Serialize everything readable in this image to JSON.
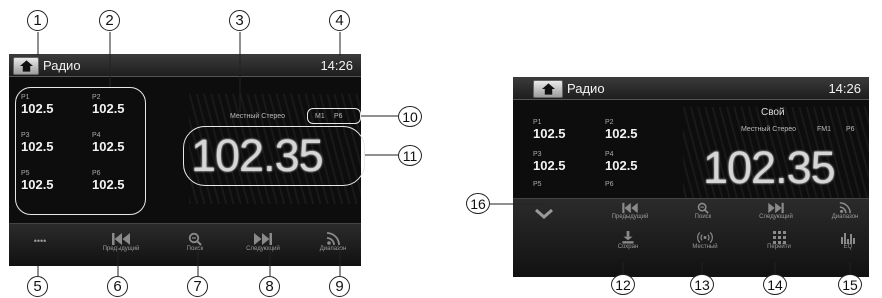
{
  "left_screen": {
    "title": "Радио",
    "clock": "14:26",
    "stereo_label": "Местный Стерео",
    "band": "M1",
    "preset_indicator": "P6",
    "frequency": "102.35",
    "presets": [
      {
        "label": "P1",
        "freq": "102.5"
      },
      {
        "label": "P2",
        "freq": "102.5"
      },
      {
        "label": "P3",
        "freq": "102.5"
      },
      {
        "label": "P4",
        "freq": "102.5"
      },
      {
        "label": "P5",
        "freq": "102.5"
      },
      {
        "label": "P6",
        "freq": "102.5"
      }
    ],
    "controls": {
      "more": "••••",
      "prev": "Предыдущий",
      "search": "Поиск",
      "next": "Следующий",
      "band": "Диапазон"
    }
  },
  "right_screen": {
    "title": "Радио",
    "clock": "14:26",
    "own_label": "Свой",
    "stereo_label": "Местный Стерео",
    "band": "FM1",
    "preset_indicator": "P6",
    "frequency": "102.35",
    "presets": [
      {
        "label": "P1",
        "freq": "102.5"
      },
      {
        "label": "P2",
        "freq": "102.5"
      },
      {
        "label": "P3",
        "freq": "102.5"
      },
      {
        "label": "P4",
        "freq": "102.5"
      },
      {
        "label": "P5",
        "freq": ""
      },
      {
        "label": "P6",
        "freq": ""
      }
    ],
    "controls": {
      "prev": "Предыдущий",
      "search": "Поиск",
      "next": "Следующий",
      "band": "Диапазон",
      "save": "Сохран",
      "local": "Местный",
      "goto": "Перейти",
      "eq": "EQ"
    }
  },
  "callouts": [
    "1",
    "2",
    "3",
    "4",
    "5",
    "6",
    "7",
    "8",
    "9",
    "10",
    "11",
    "12",
    "13",
    "14",
    "15",
    "16"
  ],
  "colors": {
    "screen_bg": "#0d0d0d",
    "text": "#f2f2f2",
    "muted": "#9a9a9a",
    "frame": "#e8e8e8"
  }
}
